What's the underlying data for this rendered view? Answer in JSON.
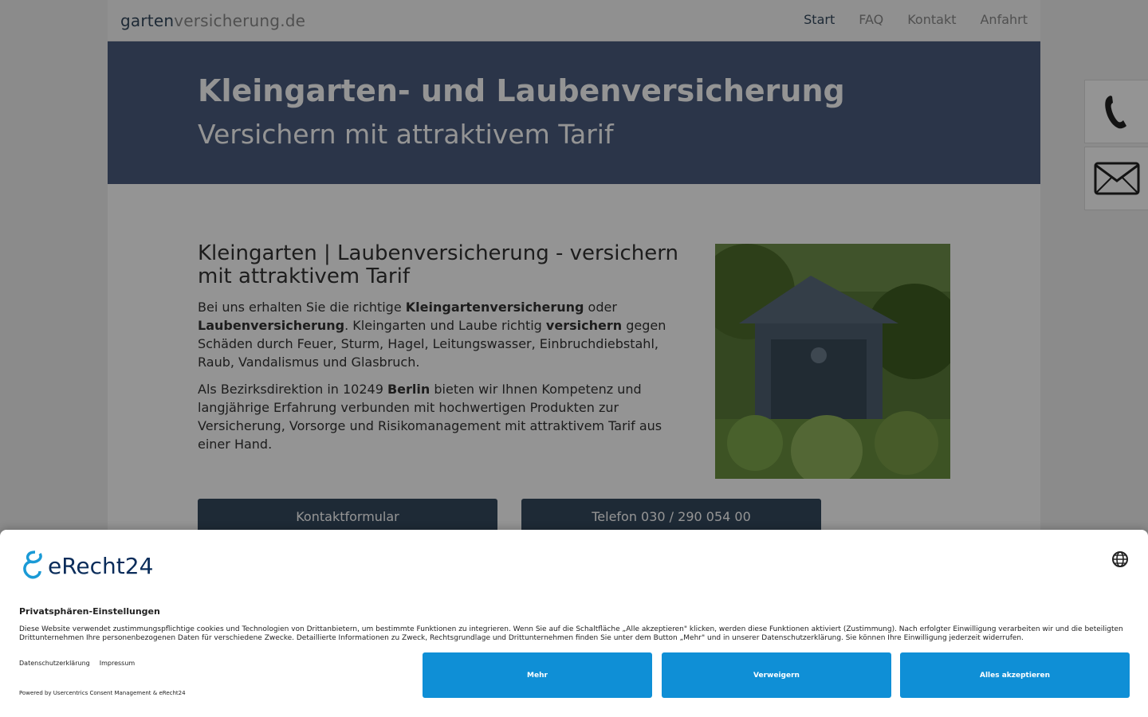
{
  "nav": {
    "brand_part1": "garten",
    "brand_part2": "versicherung.de",
    "items": [
      {
        "label": "Start"
      },
      {
        "label": "FAQ"
      },
      {
        "label": "Kontakt"
      },
      {
        "label": "Anfahrt"
      }
    ]
  },
  "hero": {
    "title": "Kleingarten- und Laubenversicherung",
    "subtitle": "Versichern mit attraktivem Tarif"
  },
  "main": {
    "heading": "Kleingarten | Laubenversicherung - versichern mit attraktivem Tarif",
    "p1": {
      "a": "Bei uns erhalten Sie die richtige ",
      "b": "Kleingartenversicherung",
      "c": " oder ",
      "d": "Laubenversicherung",
      "e": ". Kleingarten und Laube richtig ",
      "f": "versichern",
      "g": " gegen Schäden durch Feuer, Sturm, Hagel, Leitungswasser, Einbruchdiebstahl, Raub, Vandalismus und Glasbruch."
    },
    "p2": {
      "a": "Als Bezirksdirektion in 10249 ",
      "b": "Berlin",
      "c": " bieten wir Ihnen Kompetenz und langjährige Erfahrung verbunden mit hochwertigen Produkten zur Versicherung, Vorsorge und Risikomanagement mit attraktivem Tarif aus einer Hand."
    },
    "button_contact": "Kontaktformular",
    "button_phone": "Telefon 030 / 290 054 00"
  },
  "side": {
    "phone_icon": "phone-icon",
    "mail_icon": "mail-icon"
  },
  "consent": {
    "logo_text": "eRecht24",
    "title": "Privatsphären-Einstellungen",
    "text": "Diese Website verwendet zustimmungspflichtige cookies und Technologien von Drittanbietern, um bestimmte Funktionen zu integrieren. Wenn Sie auf die Schaltfläche „Alle akzeptieren\" klicken, werden diese Funktionen aktiviert (Zustimmung). Nach erfolgter Einwilligung verarbeiten wir und die beteiligten Drittunternehmen Ihre personenbezogenen Daten für verschiedene Zwecke. Detaillierte Informationen zu Zweck, Rechtsgrundlage und Drittunternehmen finden Sie unter dem Button „Mehr\" und in unserer Datenschutzerklärung. Sie können Ihre Einwilligung jederzeit widerrufen.",
    "link_privacy": "Datenschutzerklärung",
    "link_imprint": "Impressum",
    "powered": "Powered by Usercentrics Consent Management & eRecht24",
    "btn_more": "Mehr",
    "btn_deny": "Verweigern",
    "btn_accept": "Alles akzeptieren",
    "accent_color": "#0f8fd6"
  }
}
